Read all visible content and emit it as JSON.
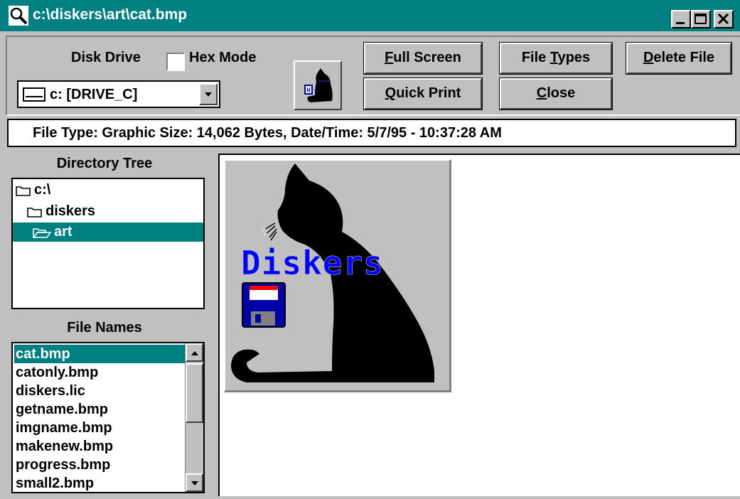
{
  "window": {
    "title": "c:\\diskers\\art\\cat.bmp",
    "title_icon": "magnifier-icon",
    "controls": [
      "minimize-icon",
      "maximize-icon",
      "close-icon"
    ]
  },
  "toolbar": {
    "disk_drive_label": "Disk Drive",
    "hex_mode_label": "Hex Mode",
    "hex_mode_checked": false,
    "drive_combo_value": "c: [DRIVE_C]",
    "view_button_icon": "cat-icon",
    "buttons": {
      "full_screen": {
        "accel": "F",
        "rest": "ull Screen"
      },
      "quick_print": {
        "accel": "Q",
        "rest": "uick Print"
      },
      "file_types": {
        "pre": "File ",
        "accel": "T",
        "rest": "ypes"
      },
      "close": {
        "accel": "C",
        "rest": "lose"
      },
      "delete_file": {
        "accel": "D",
        "rest": "elete File"
      }
    }
  },
  "info": {
    "text": "File Type: Graphic   Size: 14,062 Bytes, Date/Time: 5/7/95 - 10:37:28 AM"
  },
  "directory_tree": {
    "title": "Directory Tree",
    "items": [
      {
        "label": "c:\\",
        "icon": "folder-closed-icon",
        "selected": false
      },
      {
        "label": "diskers",
        "icon": "folder-closed-icon",
        "selected": false
      },
      {
        "label": "art",
        "icon": "folder-open-icon",
        "selected": true
      }
    ]
  },
  "file_names": {
    "title": "File Names",
    "items": [
      "cat.bmp",
      "catonly.bmp",
      "diskers.lic",
      "getname.bmp",
      "imgname.bmp",
      "makenew.bmp",
      "progress.bmp",
      "small2.bmp"
    ],
    "selected_index": 0
  },
  "preview": {
    "image_text": "Diskers",
    "image_colors": {
      "background": "#c0c0c0",
      "cat": "#000000",
      "text": "#0000ff",
      "disk_blue": "#0000a8",
      "disk_red": "#ff0000"
    }
  }
}
